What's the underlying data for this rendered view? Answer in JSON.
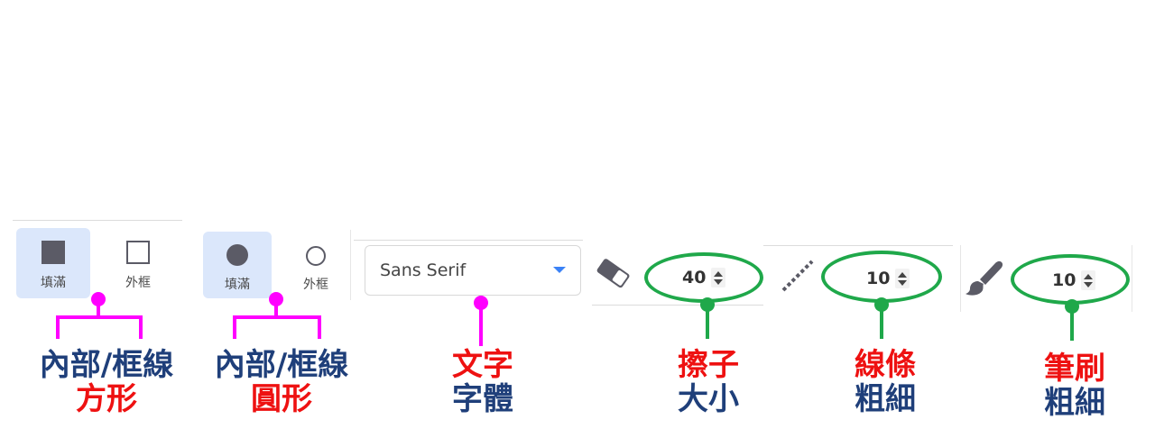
{
  "shape_rect": {
    "fill_label": "填滿",
    "outline_label": "外框"
  },
  "shape_circle": {
    "fill_label": "填滿",
    "outline_label": "外框"
  },
  "font_select": {
    "value": "Sans Serif"
  },
  "eraser_size": {
    "value": "40"
  },
  "line_width": {
    "value": "10"
  },
  "brush_width": {
    "value": "10"
  },
  "annotations": {
    "rect": {
      "line1": "內部/框線",
      "line2": "方形"
    },
    "circle": {
      "line1": "內部/框線",
      "line2": "圓形"
    },
    "text": {
      "line1": "文字",
      "line2": "字體"
    },
    "eraser": {
      "line1": "擦子",
      "line2": "大小"
    },
    "line": {
      "line1": "線條",
      "line2": "粗細"
    },
    "brush": {
      "line1": "筆刷",
      "line2": "粗細"
    }
  },
  "colors": {
    "selected_bg": "#dbe7fb",
    "highlight_green": "#1fa84a",
    "pointer_magenta": "#ff00ff",
    "caption_blue": "#1f3f7a",
    "caption_red": "#ee1111"
  }
}
